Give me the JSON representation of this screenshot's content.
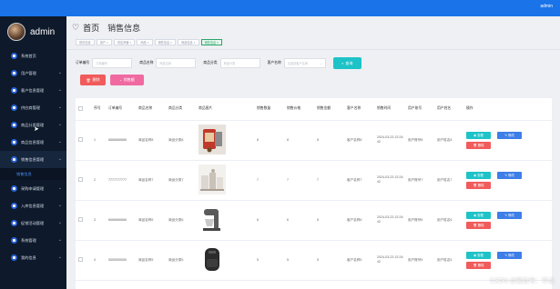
{
  "topbar": {
    "user": "admin"
  },
  "brand": {
    "name": "admin"
  },
  "sidebar": {
    "items": [
      {
        "label": "系统首页",
        "chevron": false
      },
      {
        "label": "用户管理",
        "chevron": true
      },
      {
        "label": "客户信息管理",
        "chevron": true
      },
      {
        "label": "供应商管理",
        "chevron": true
      },
      {
        "label": "商品分类管理",
        "chevron": true
      },
      {
        "label": "商品信息管理",
        "chevron": true
      },
      {
        "label": "销售信息管理",
        "chevron": true,
        "active": true
      },
      {
        "label": "采购申请管理",
        "chevron": true
      },
      {
        "label": "入库信息管理",
        "chevron": true
      },
      {
        "label": "促销活动管理",
        "chevron": true
      },
      {
        "label": "系统管理",
        "chevron": true
      },
      {
        "label": "我的信息",
        "chevron": true
      }
    ],
    "submenu": {
      "label": "销售信息"
    }
  },
  "header": {
    "home": "首页",
    "page": "销售信息"
  },
  "tags": [
    "首页信息",
    "用户 ×",
    "供应商管 ×",
    "商品 ×",
    "销售信息 ×",
    "商品信息 ×",
    "销售信息 ×"
  ],
  "search": {
    "order_label": "订单编号",
    "order_placeholder": "订单编号",
    "name_label": "商品名称",
    "name_placeholder": "商品名称",
    "category_label": "商品分类",
    "category_placeholder": "商品分类",
    "customer_label": "客户名称",
    "customer_placeholder": "请选择客户名称",
    "query_label": "查询"
  },
  "actions": {
    "delete": "删除",
    "stats": "销售额"
  },
  "table": {
    "headers": [
      "",
      "序号",
      "订单编号",
      "商品名称",
      "商品分类",
      "商品图片",
      "销售数量",
      "销售价格",
      "销售金额",
      "客户名称",
      "销售时间",
      "用户账号",
      "用户姓名",
      "操作"
    ],
    "rows": [
      {
        "index": "1",
        "order": "8888888888",
        "name": "商品名称8",
        "category": "商品分类8",
        "image": "coffee-machine",
        "qty": "8",
        "price": "8",
        "amount": "8",
        "customer": "客户名称8",
        "time": "2024-03-23 12:24:42",
        "account": "用户账号8",
        "username": "用户姓名8"
      },
      {
        "index": "2",
        "order": "7777777777",
        "name": "商品名称7",
        "category": "商品分类7",
        "image": "kitchen-appliances",
        "qty": "7",
        "price": "7",
        "amount": "7",
        "customer": "客户名称7",
        "time": "2024-03-23 12:24:42",
        "account": "用户账号7",
        "username": "用户姓名7"
      },
      {
        "index": "3",
        "order": "6666666666",
        "name": "商品名称6",
        "category": "商品分类6",
        "image": "stand-mixer",
        "qty": "6",
        "price": "6",
        "amount": "6",
        "customer": "客户名称6",
        "time": "2024-03-23 12:24:42",
        "account": "用户账号6",
        "username": "用户姓名6"
      },
      {
        "index": "4",
        "order": "5555555555",
        "name": "商品名称5",
        "category": "商品分类5",
        "image": "air-fryer",
        "qty": "5",
        "price": "5",
        "amount": "5",
        "customer": "客户名称5",
        "time": "2024-03-23 12:24:42",
        "account": "用户账号5",
        "username": "用户姓名5"
      }
    ],
    "op_view": "查看",
    "op_edit": "修改",
    "op_delete": "删除"
  },
  "watermark": "CSDN @微信号：毕设"
}
